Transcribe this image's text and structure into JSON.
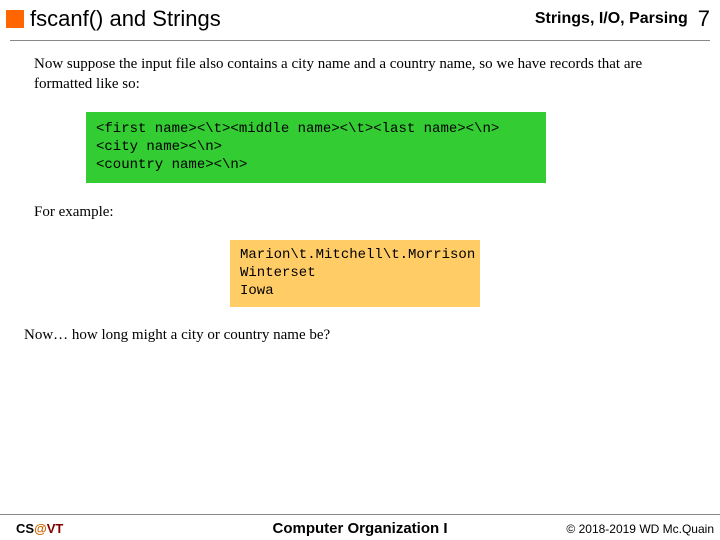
{
  "header": {
    "title": "fscanf() and Strings",
    "subtitle": "Strings, I/O, Parsing",
    "page": "7"
  },
  "content": {
    "para1": "Now suppose the input file also contains a city name and a country name, so we have records that are formatted like so:",
    "codebox1": "<first name><\\t><middle name><\\t><last name><\\n>\n<city name><\\n>\n<country name><\\n>",
    "para2": "For example:",
    "codebox2": "Marion\\t.Mitchell\\t.Morrison\nWinterset\nIowa",
    "para3": "Now… how long might a city or country name be?"
  },
  "footer": {
    "left_cs": "CS",
    "left_at": "@",
    "left_vt": "VT",
    "center": "Computer Organization I",
    "right": "© 2018-2019 WD Mc.Quain"
  }
}
